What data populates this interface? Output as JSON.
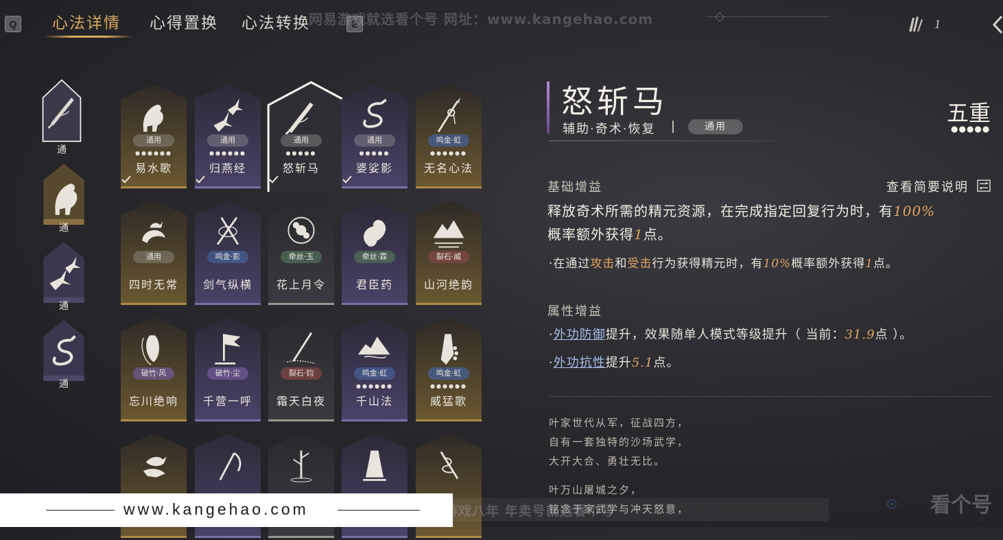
{
  "topbar": {
    "key_left": "Q",
    "key_right": "E",
    "tabs": [
      {
        "label": "心法详情",
        "active": true
      },
      {
        "label": "心得置换",
        "active": false
      },
      {
        "label": "心法转换",
        "active": false
      }
    ],
    "watermark": "网易游戏就选看个号  网址：www.kangehao.com",
    "feather_count": "1"
  },
  "categories": [
    {
      "label": "通",
      "icon": "sword-icon",
      "selected": true
    },
    {
      "label": "通",
      "icon": "horse-icon",
      "selected": false
    },
    {
      "label": "通",
      "icon": "swallows-icon",
      "selected": false
    },
    {
      "label": "通",
      "icon": "dragon-icon",
      "selected": false
    }
  ],
  "cards": [
    {
      "name": "易水歌",
      "badge": "通用",
      "badge_style": "tongyong",
      "dots": "●●●●●●",
      "icon": "horse-icon",
      "tone": "gold",
      "owned": true
    },
    {
      "name": "归燕经",
      "badge": "通用",
      "badge_style": "tongyong",
      "dots": "●●●●●●",
      "icon": "swallows-icon",
      "tone": "purple",
      "owned": true
    },
    {
      "name": "怒斩马",
      "badge": "通用",
      "badge_style": "tongyong",
      "dots": "●●●●●",
      "icon": "sword-icon",
      "tone": "dark",
      "owned": true,
      "selected": true
    },
    {
      "name": "婆娑影",
      "badge": "通用",
      "badge_style": "tongyong",
      "dots": "●●●●●",
      "icon": "dragon-icon",
      "tone": "purple",
      "owned": true
    },
    {
      "name": "无名心法",
      "badge": "鸣金·虹",
      "badge_style": "blue",
      "dots": "●●●●●●",
      "icon": "spear-icon",
      "tone": "gold",
      "owned": false
    },
    {
      "name": "四时无常",
      "badge": "通用",
      "badge_style": "tongyong",
      "icon": "moon-rabbit-icon",
      "tone": "gold",
      "owned": false
    },
    {
      "name": "剑气纵横",
      "badge": "鸣金·影",
      "badge_style": "blue",
      "icon": "blades-icon",
      "tone": "purple",
      "owned": false
    },
    {
      "name": "花上月令",
      "badge": "牵丝·玉",
      "badge_style": "green",
      "icon": "peony-icon",
      "tone": "dark",
      "owned": false
    },
    {
      "name": "君臣药",
      "badge": "牵丝·霖",
      "badge_style": "green",
      "icon": "gourd-icon",
      "tone": "purple",
      "owned": false
    },
    {
      "name": "山河绝韵",
      "badge": "裂石·威",
      "badge_style": "red",
      "icon": "mountain-icon",
      "tone": "gold",
      "owned": false
    },
    {
      "name": "忘川绝响",
      "badge": "破竹·风",
      "badge_style": "purple",
      "icon": "mask-icon",
      "tone": "gold",
      "owned": false
    },
    {
      "name": "千营一呼",
      "badge": "破竹·尘",
      "badge_style": "purple",
      "icon": "banner-icon",
      "tone": "purple",
      "owned": false
    },
    {
      "name": "霜天白夜",
      "badge": "裂石·钧",
      "badge_style": "red",
      "icon": "pen-icon",
      "tone": "dark",
      "owned": false
    },
    {
      "name": "千山法",
      "badge": "鸣金·虹",
      "badge_style": "blue",
      "dots": "●●●●●●",
      "icon": "peaks-icon",
      "tone": "purple",
      "owned": false
    },
    {
      "name": "威猛歌",
      "badge": "鸣金·虹",
      "badge_style": "blue",
      "dots": "●●●●●●",
      "icon": "beads-hand-icon",
      "tone": "gold",
      "owned": false
    },
    {
      "name": "",
      "icon": "bird-hand-icon",
      "tone": "gold"
    },
    {
      "name": "",
      "icon": "scythe-icon",
      "tone": "purple"
    },
    {
      "name": "",
      "icon": "bamboo-icon",
      "tone": "dark"
    },
    {
      "name": "",
      "icon": "statue-icon",
      "tone": "purple"
    },
    {
      "name": "",
      "icon": "caduceus-icon",
      "tone": "gold"
    }
  ],
  "detail": {
    "title": "怒斩马",
    "tags": "辅助·奇术·恢复",
    "badge": "通用",
    "tier": "五重",
    "tier_dots": "●●●●●",
    "base_header": "基础增益",
    "summary_link": "查看简要说明",
    "main_a": "释放奇术所需的精元资源，在完成指定回复行为时，有",
    "main_pct": "100%",
    "main_b": "概率额外获得",
    "main_num": "1",
    "main_c": "点。",
    "sub_a": "·在通过",
    "sub_attack": "攻击",
    "sub_and": "和",
    "sub_hit": "受击",
    "sub_b": "行为获得精元时，有",
    "sub_pct": "10%",
    "sub_c": "概率额外获得",
    "sub_num": "1",
    "sub_d": "点。",
    "attr_header": "属性增益",
    "attr1_dot": "·",
    "attr1_link": "外功防御",
    "attr1_a": "提升，效果随单人模式等级提升（ 当前：",
    "attr1_val": "31.9",
    "attr1_b": "点 ）。",
    "attr2_dot": "·",
    "attr2_link": "外功抗性",
    "attr2_a": "提升",
    "attr2_val": "5.1",
    "attr2_b": "点。",
    "lore": [
      "叶家世代从军，征战四方，",
      "自有一套独特的沙场武学，",
      "大开大合、勇壮无比。",
      "叶万山屠城之夕，",
      "铭念于家武学与冲天怒意，"
    ]
  },
  "footer": {
    "url": "www.kangehao.com",
    "banner": "看个号专业网易游戏八年  年卖号就选看个号",
    "brand": "看个号"
  },
  "colors": {
    "accent_gold": "#d8a85a",
    "highlight_orange": "#e3a561",
    "link_blue": "#a9bde8",
    "title_purple": "#b58ad8"
  }
}
